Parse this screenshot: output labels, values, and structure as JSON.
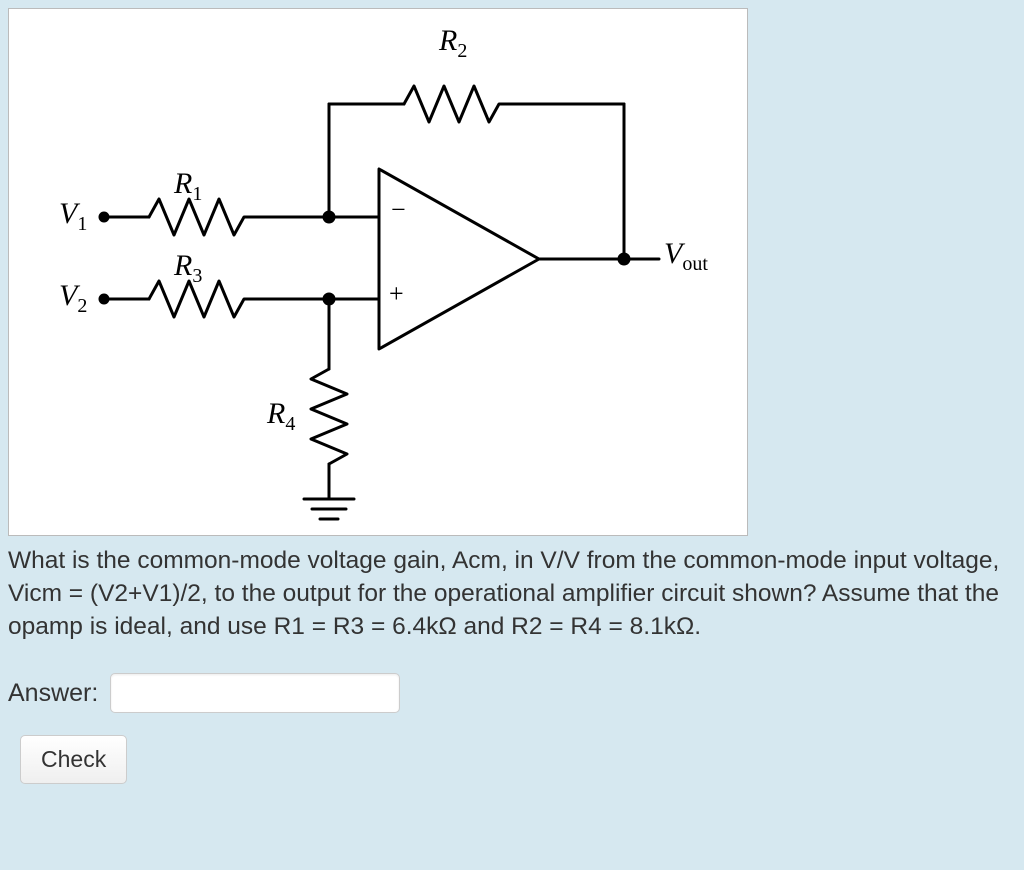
{
  "circuit": {
    "labels": {
      "R1": "R",
      "R1_sub": "1",
      "R2": "R",
      "R2_sub": "2",
      "R3": "R",
      "R3_sub": "3",
      "R4": "R",
      "R4_sub": "4",
      "V1": "V",
      "V1_sub": "1",
      "V2": "V",
      "V2_sub": "2",
      "Vout": "V",
      "Vout_sub": "out",
      "plus": "+",
      "minus": "−"
    }
  },
  "question": {
    "text": "What is the common-mode voltage gain, Acm, in V/V from the common-mode input voltage, Vicm = (V2+V1)/2, to the output for the operational amplifier circuit shown? Assume that the opamp is ideal, and use R1 = R3 = 6.4kΩ and R2 = R4 = 8.1kΩ."
  },
  "form": {
    "answer_label": "Answer:",
    "answer_value": "",
    "check_label": "Check"
  }
}
